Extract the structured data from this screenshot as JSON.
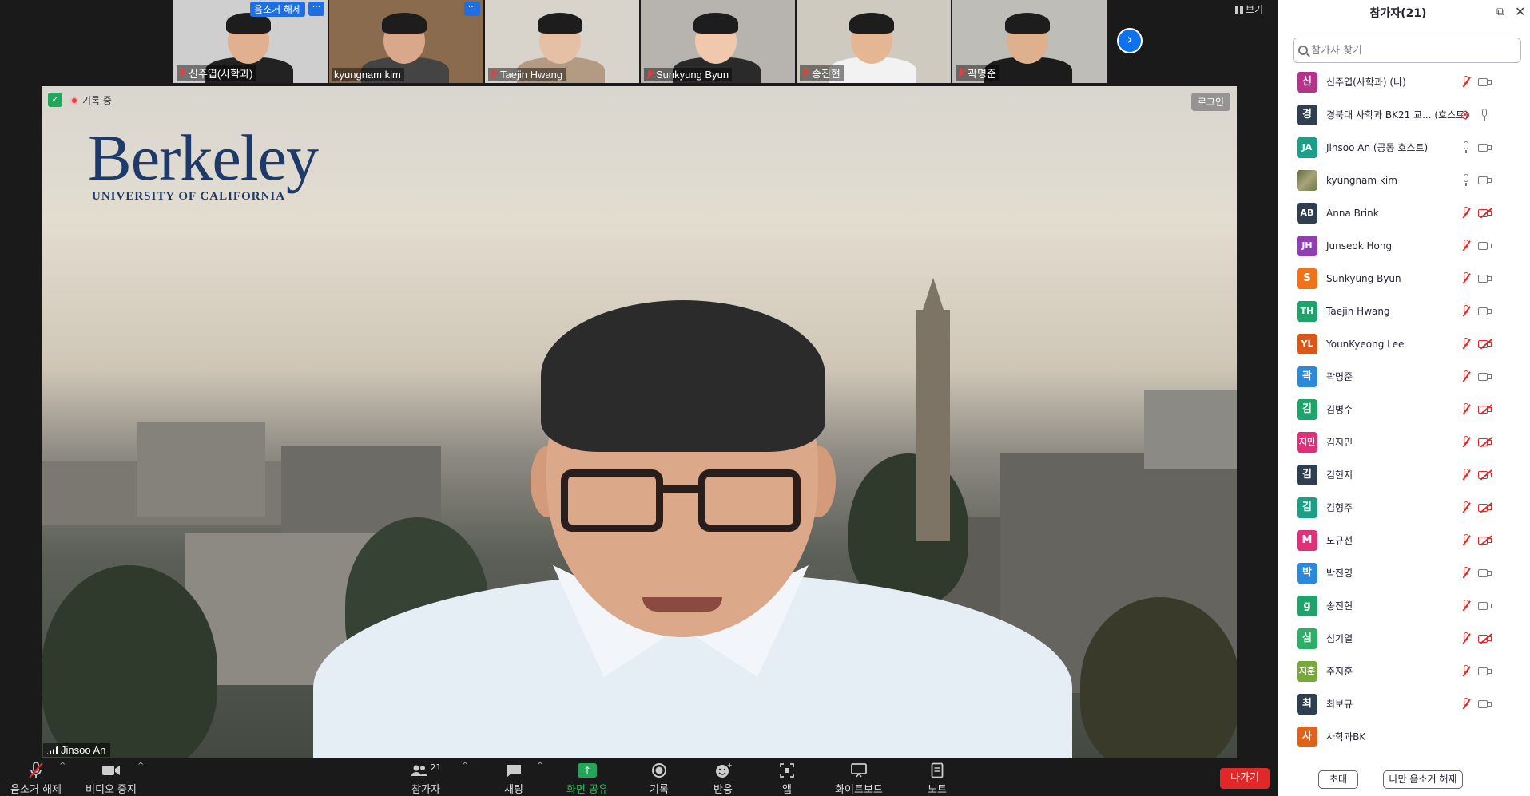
{
  "thumbnails": [
    {
      "name": "신주엽(사학과)",
      "muted": true,
      "tag": "음소거 해제",
      "more": "···",
      "bg": "#cfcfcf",
      "face": "#e0b08f",
      "shirt": "#222"
    },
    {
      "name": "kyungnam kim",
      "muted": false,
      "more": "···",
      "bg": "#8a6b4d",
      "face": "#d9a78a",
      "shirt": "#444"
    },
    {
      "name": "Taejin Hwang",
      "muted": true,
      "bg": "#d8d4cc",
      "face": "#e6c0a5",
      "shirt": "#b39a82"
    },
    {
      "name": "Sunkyung Byun",
      "muted": true,
      "bg": "#b7b3ae",
      "face": "#f0c8ae",
      "shirt": "#2a2a2a"
    },
    {
      "name": "송진현",
      "muted": true,
      "bg": "#cfcac0",
      "face": "#e4b694",
      "shirt": "#f2f2f2"
    },
    {
      "name": "곽명준",
      "muted": true,
      "bg": "#bfbdb7",
      "face": "#deb08e",
      "shirt": "#1c1c1c"
    }
  ],
  "thumb_next": "›",
  "view_label": "보기",
  "main_video": {
    "logo_big": "Berkeley",
    "logo_small": "UNIVERSITY OF CALIFORNIA",
    "recording_label": "기록 중",
    "login_label": "로그인",
    "speaker_name": "Jinsoo An",
    "secure_symbol": "✓"
  },
  "toolbar": {
    "unmute": "음소거 해제",
    "stop_video": "비디오 중지",
    "participants": "참가자",
    "participants_count": "21",
    "chat": "채팅",
    "share": "화면 공유",
    "record": "기록",
    "reactions": "반응",
    "apps": "앱",
    "whiteboard": "화이트보드",
    "notes": "노트",
    "leave": "나가기",
    "caret": "^"
  },
  "panel": {
    "title": "참가자(21)",
    "search_placeholder": "참가자 찾기",
    "popout": "⧉",
    "close": "✕",
    "invite": "초대",
    "unmute_me": "나만 음소거 해제",
    "participants": [
      {
        "avatar": "신",
        "color": "#b5338a",
        "name": "신주엽(사학과) (나)",
        "mic": "muted",
        "cam": "on"
      },
      {
        "avatar": "경",
        "color": "#2f3e50",
        "name": "경북대 사학과 BK21 교...  (호스트)",
        "mic": "host",
        "cam": "mic"
      },
      {
        "avatar": "JA",
        "color": "#1e9e86",
        "name": "Jinsoo An (공동 호스트)",
        "mic": "on",
        "cam": "on"
      },
      {
        "avatar": "",
        "color": "#7b8b5a",
        "name": "kyungnam kim",
        "mic": "on",
        "cam": "on",
        "photo": true
      },
      {
        "avatar": "AB",
        "color": "#2f3e50",
        "name": "Anna Brink",
        "mic": "muted",
        "cam": "off"
      },
      {
        "avatar": "JH",
        "color": "#8e3fb2",
        "name": "Junseok Hong",
        "mic": "muted",
        "cam": "on"
      },
      {
        "avatar": "S",
        "color": "#f0731c",
        "name": "Sunkyung Byun",
        "mic": "muted",
        "cam": "on"
      },
      {
        "avatar": "TH",
        "color": "#1ea36b",
        "name": "Taejin Hwang",
        "mic": "muted",
        "cam": "on"
      },
      {
        "avatar": "YL",
        "color": "#d9591a",
        "name": "YounKyeong Lee",
        "mic": "muted",
        "cam": "off"
      },
      {
        "avatar": "곽",
        "color": "#2c88d9",
        "name": "곽명준",
        "mic": "muted",
        "cam": "on"
      },
      {
        "avatar": "김",
        "color": "#1ea36b",
        "name": "김병수",
        "mic": "muted",
        "cam": "off"
      },
      {
        "avatar": "지민",
        "color": "#e0307a",
        "name": "김지민",
        "mic": "muted",
        "cam": "off"
      },
      {
        "avatar": "김",
        "color": "#2f3e50",
        "name": "김현지",
        "mic": "muted",
        "cam": "off"
      },
      {
        "avatar": "김",
        "color": "#1e9e86",
        "name": "김형주",
        "mic": "muted",
        "cam": "off"
      },
      {
        "avatar": "M",
        "color": "#e0307a",
        "name": "노규선",
        "mic": "muted",
        "cam": "off"
      },
      {
        "avatar": "박",
        "color": "#2c88d9",
        "name": "박진영",
        "mic": "muted",
        "cam": "on"
      },
      {
        "avatar": "g",
        "color": "#1ea36b",
        "name": "송진현",
        "mic": "muted",
        "cam": "on"
      },
      {
        "avatar": "심",
        "color": "#2fae6a",
        "name": "심기열",
        "mic": "muted",
        "cam": "off"
      },
      {
        "avatar": "지훈",
        "color": "#79a83a",
        "name": "주지훈",
        "mic": "muted",
        "cam": "on"
      },
      {
        "avatar": "최",
        "color": "#2f3e50",
        "name": "최보규",
        "mic": "muted",
        "cam": "on"
      },
      {
        "avatar": "사",
        "color": "#e0631c",
        "name": "사학과BK",
        "mic": "none",
        "cam": "none"
      }
    ]
  }
}
